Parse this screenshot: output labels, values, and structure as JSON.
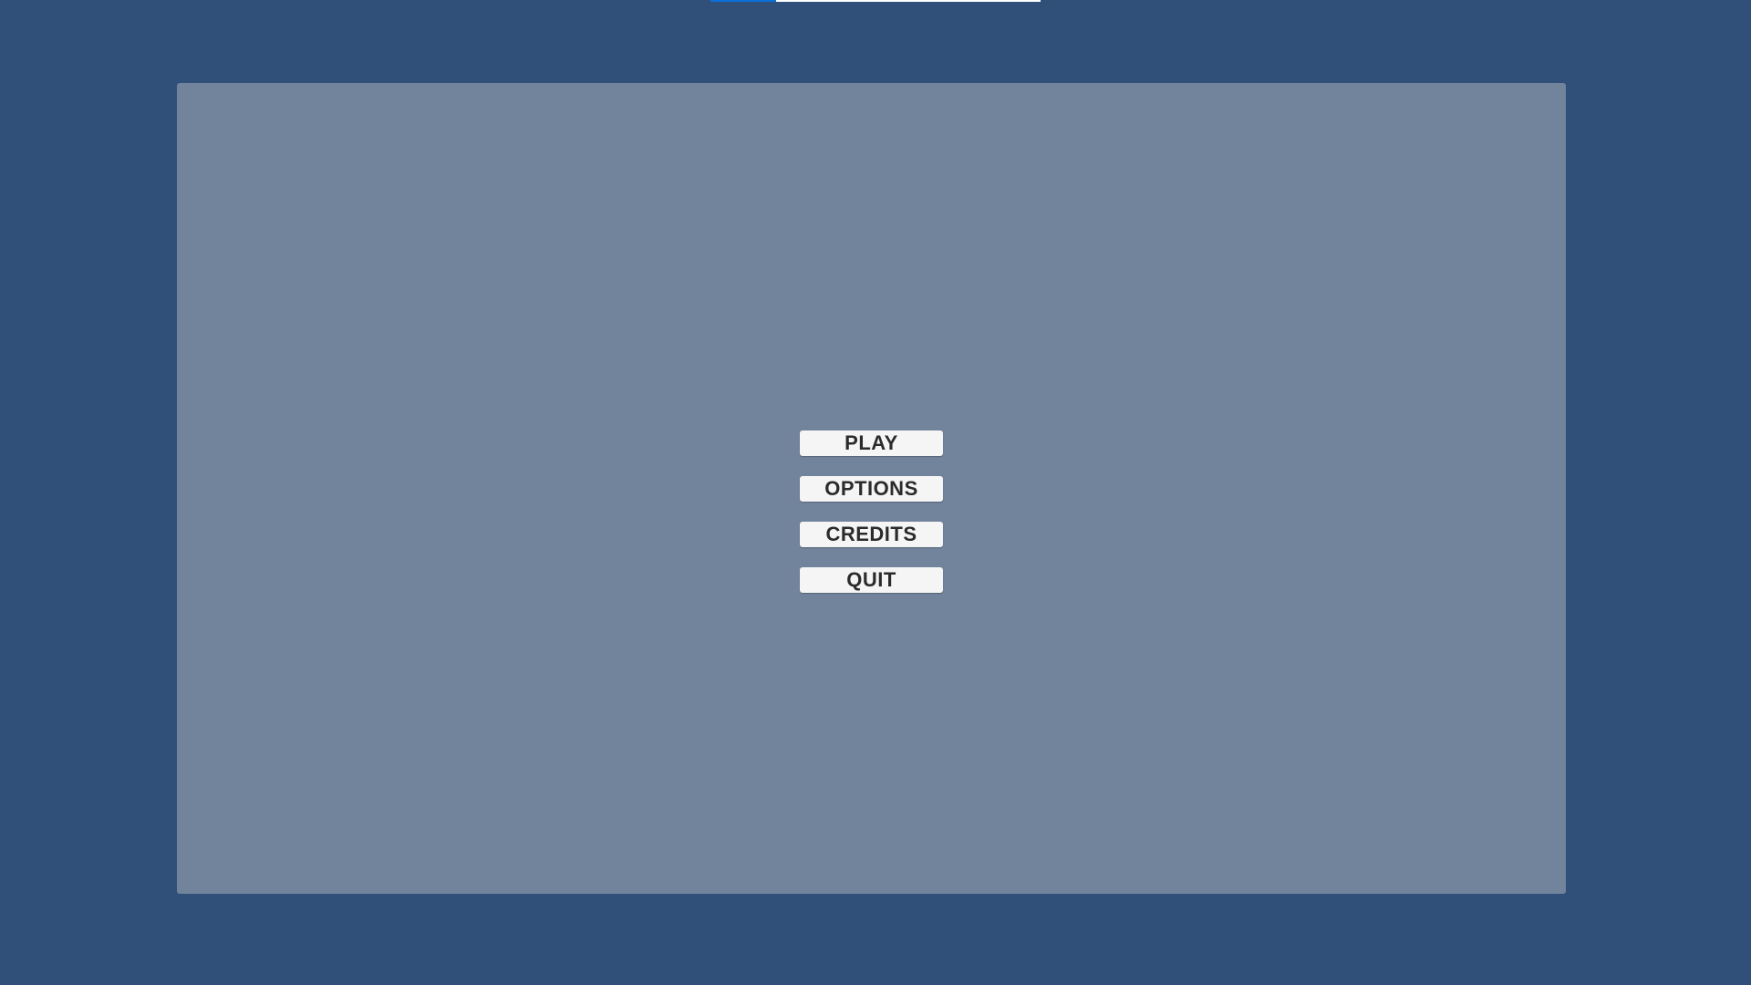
{
  "colors": {
    "background": "#30507a",
    "panel": "#72839c",
    "button_bg": "#f5f5f5",
    "button_text": "#2b2b2b",
    "progress_fill": "#0a6fd8"
  },
  "loading_bar": {
    "progress": 0.2
  },
  "menu": {
    "buttons": [
      {
        "label": "PLAY"
      },
      {
        "label": "OPTIONS"
      },
      {
        "label": "CREDITS"
      },
      {
        "label": "QUIT"
      }
    ]
  }
}
